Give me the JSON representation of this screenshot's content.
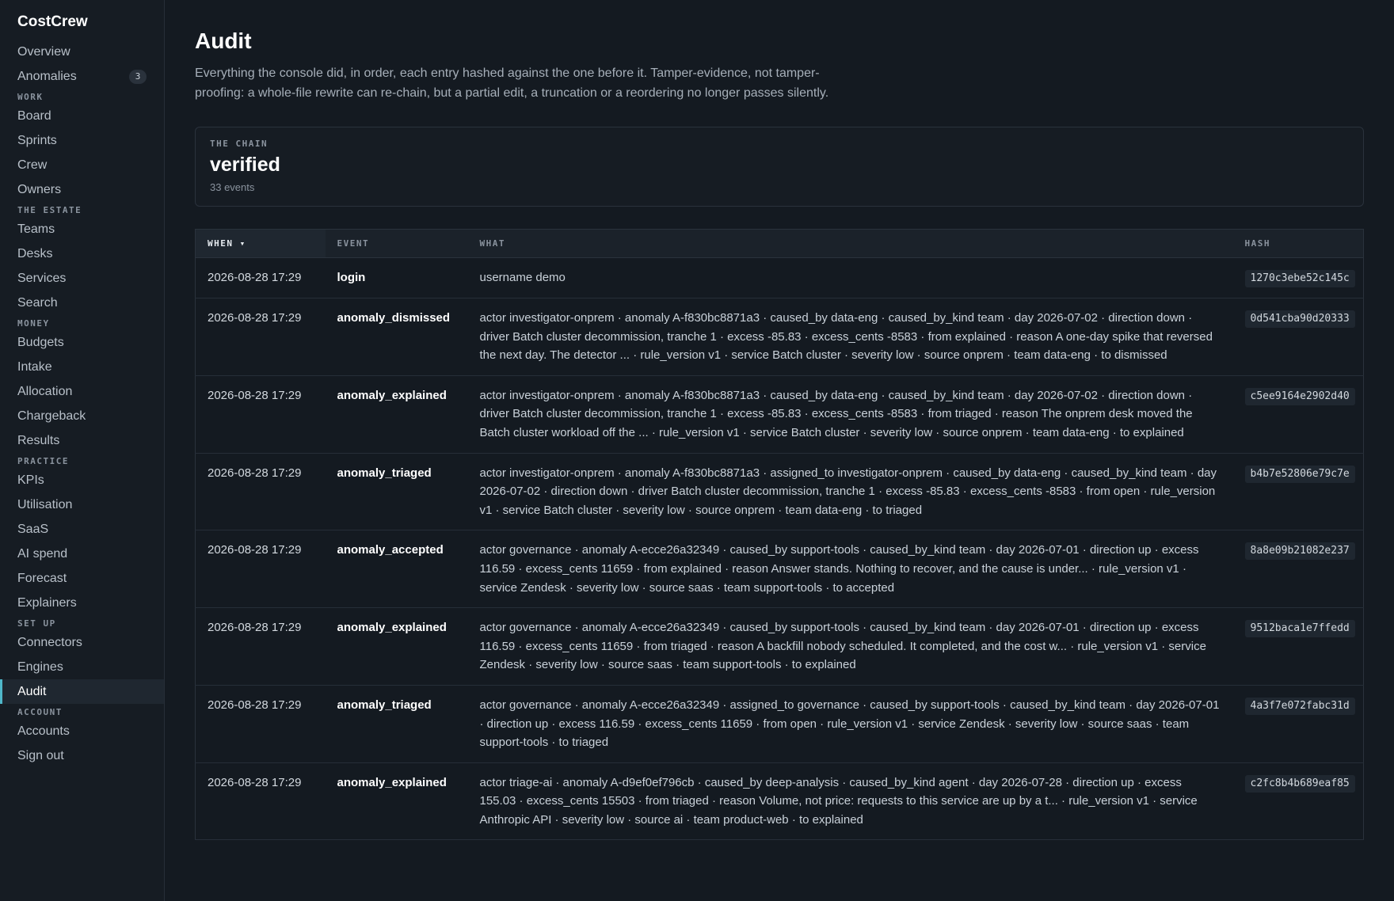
{
  "app": {
    "name": "CostCrew"
  },
  "sidebar": {
    "top": [
      {
        "label": "Overview"
      },
      {
        "label": "Anomalies",
        "badge": "3"
      }
    ],
    "groups": [
      {
        "label": "WORK",
        "items": [
          "Board",
          "Sprints",
          "Crew",
          "Owners"
        ]
      },
      {
        "label": "THE ESTATE",
        "items": [
          "Teams",
          "Desks",
          "Services",
          "Search"
        ]
      },
      {
        "label": "MONEY",
        "items": [
          "Budgets",
          "Intake",
          "Allocation",
          "Chargeback",
          "Results"
        ]
      },
      {
        "label": "PRACTICE",
        "items": [
          "KPIs",
          "Utilisation",
          "SaaS",
          "AI spend",
          "Forecast",
          "Explainers"
        ]
      },
      {
        "label": "SET UP",
        "items": [
          "Connectors",
          "Engines",
          "Audit"
        ]
      },
      {
        "label": "ACCOUNT",
        "items": [
          "Accounts",
          "Sign out"
        ]
      }
    ],
    "active": "Audit"
  },
  "page": {
    "title": "Audit",
    "description": "Everything the console did, in order, each entry hashed against the one before it. Tamper-evidence, not tamper-proofing: a whole-file rewrite can re-chain, but a partial edit, a truncation or a reordering no longer passes silently."
  },
  "chain": {
    "label": "THE CHAIN",
    "status": "verified",
    "count": "33 events"
  },
  "table": {
    "columns": {
      "when": "WHEN ▾",
      "event": "EVENT",
      "what": "WHAT",
      "hash": "HASH"
    },
    "rows": [
      {
        "when": "2026-08-28 17:29",
        "event": "login",
        "what": "username demo",
        "hash": "1270c3ebe52c145c"
      },
      {
        "when": "2026-08-28 17:29",
        "event": "anomaly_dismissed",
        "what": "actor investigator-onprem · anomaly A-f830bc8871a3 · caused_by data-eng · caused_by_kind team · day 2026-07-02 · direction down · driver Batch cluster decommission, tranche 1 · excess -85.83 · excess_cents -8583 · from explained · reason A one-day spike that reversed the next day. The detector ... · rule_version v1 · service Batch cluster · severity low · source onprem · team data-eng · to dismissed",
        "hash": "0d541cba90d20333"
      },
      {
        "when": "2026-08-28 17:29",
        "event": "anomaly_explained",
        "what": "actor investigator-onprem · anomaly A-f830bc8871a3 · caused_by data-eng · caused_by_kind team · day 2026-07-02 · direction down · driver Batch cluster decommission, tranche 1 · excess -85.83 · excess_cents -8583 · from triaged · reason The onprem desk moved the Batch cluster workload off the ... · rule_version v1 · service Batch cluster · severity low · source onprem · team data-eng · to explained",
        "hash": "c5ee9164e2902d40"
      },
      {
        "when": "2026-08-28 17:29",
        "event": "anomaly_triaged",
        "what": "actor investigator-onprem · anomaly A-f830bc8871a3 · assigned_to investigator-onprem · caused_by data-eng · caused_by_kind team · day 2026-07-02 · direction down · driver Batch cluster decommission, tranche 1 · excess -85.83 · excess_cents -8583 · from open · rule_version v1 · service Batch cluster · severity low · source onprem · team data-eng · to triaged",
        "hash": "b4b7e52806e79c7e"
      },
      {
        "when": "2026-08-28 17:29",
        "event": "anomaly_accepted",
        "what": "actor governance · anomaly A-ecce26a32349 · caused_by support-tools · caused_by_kind team · day 2026-07-01 · direction up · excess 116.59 · excess_cents 11659 · from explained · reason Answer stands. Nothing to recover, and the cause is under... · rule_version v1 · service Zendesk · severity low · source saas · team support-tools · to accepted",
        "hash": "8a8e09b21082e237"
      },
      {
        "when": "2026-08-28 17:29",
        "event": "anomaly_explained",
        "what": "actor governance · anomaly A-ecce26a32349 · caused_by support-tools · caused_by_kind team · day 2026-07-01 · direction up · excess 116.59 · excess_cents 11659 · from triaged · reason A backfill nobody scheduled. It completed, and the cost w... · rule_version v1 · service Zendesk · severity low · source saas · team support-tools · to explained",
        "hash": "9512baca1e7ffedd"
      },
      {
        "when": "2026-08-28 17:29",
        "event": "anomaly_triaged",
        "what": "actor governance · anomaly A-ecce26a32349 · assigned_to governance · caused_by support-tools · caused_by_kind team · day 2026-07-01 · direction up · excess 116.59 · excess_cents 11659 · from open · rule_version v1 · service Zendesk · severity low · source saas · team support-tools · to triaged",
        "hash": "4a3f7e072fabc31d"
      },
      {
        "when": "2026-08-28 17:29",
        "event": "anomaly_explained",
        "what": "actor triage-ai · anomaly A-d9ef0ef796cb · caused_by deep-analysis · caused_by_kind agent · day 2026-07-28 · direction up · excess 155.03 · excess_cents 15503 · from triaged · reason Volume, not price: requests to this service are up by a t... · rule_version v1 · service Anthropic API · severity low · source ai · team product-web · to explained",
        "hash": "c2fc8b4b689eaf85"
      }
    ]
  }
}
